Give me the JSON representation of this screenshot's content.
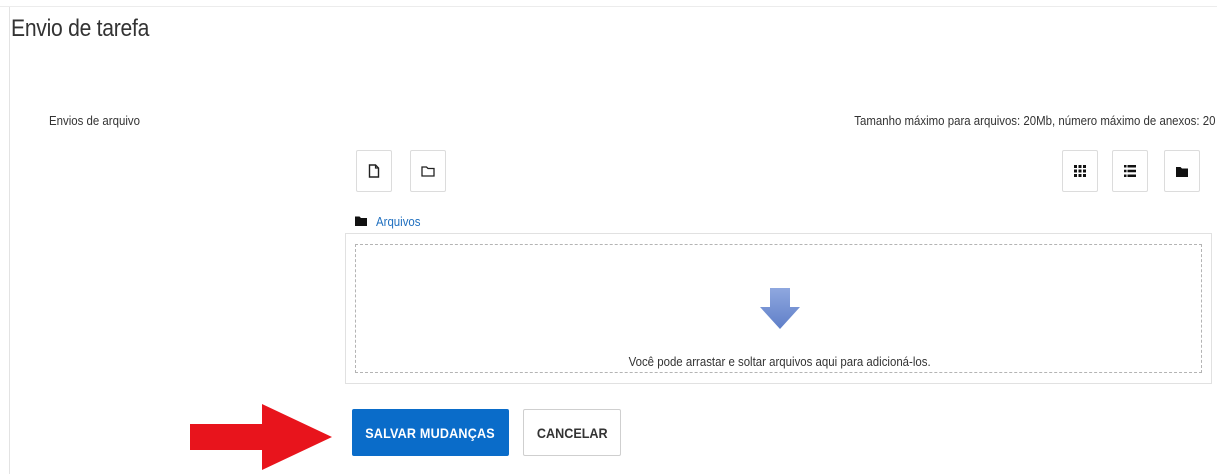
{
  "header": {
    "title": "Envio de tarefa"
  },
  "field": {
    "label": "Envios de arquivo",
    "limits": "Tamanho máximo para arquivos: 20Mb, número máximo de anexos: 20"
  },
  "toolbar": {
    "left_buttons": [
      "add-file-icon",
      "create-folder-icon"
    ],
    "right_buttons": [
      "grid-view-icon",
      "list-view-icon",
      "tree-view-icon"
    ]
  },
  "path": {
    "folder_link": "Arquivos"
  },
  "dropzone": {
    "instruction": "Você pode arrastar e soltar arquivos aqui para adicioná-los."
  },
  "actions": {
    "save_label": "SALVAR MUDANÇAS",
    "cancel_label": "CANCELAR"
  },
  "colors": {
    "primary": "#0a6cc9",
    "link": "#1f6fbf",
    "annotation_arrow": "#e8141c",
    "drop_arrow": "#7591d2"
  }
}
